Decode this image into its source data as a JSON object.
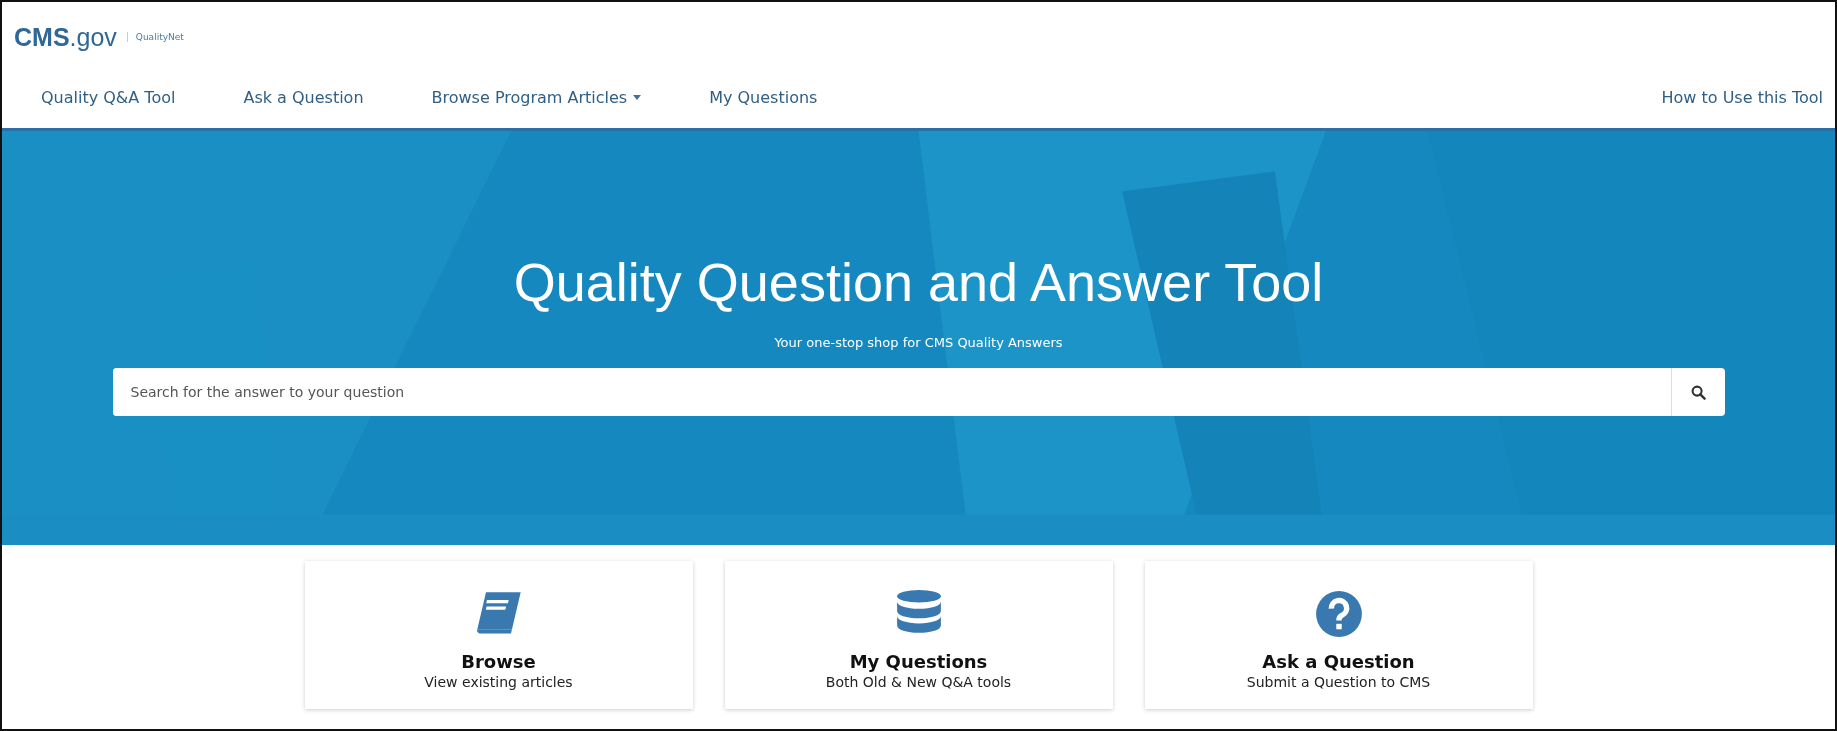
{
  "logo": {
    "brand": "CMS",
    "suffix": ".gov",
    "sub": "QualityNet"
  },
  "nav": {
    "items": [
      {
        "label": "Quality Q&A Tool",
        "dropdown": false
      },
      {
        "label": "Ask a Question",
        "dropdown": false
      },
      {
        "label": "Browse Program Articles",
        "dropdown": true
      },
      {
        "label": "My Questions",
        "dropdown": false
      }
    ],
    "right": "How to Use this Tool"
  },
  "hero": {
    "title": "Quality Question and Answer Tool",
    "subtitle": "Your one-stop shop for CMS Quality Answers",
    "search": {
      "placeholder": "Search for the answer to your question"
    }
  },
  "cards": [
    {
      "kind": "book",
      "title": "Browse",
      "subtitle": "View existing articles"
    },
    {
      "kind": "database",
      "title": "My Questions",
      "subtitle": "Both Old & New Q&A tools"
    },
    {
      "kind": "question",
      "title": "Ask a Question",
      "subtitle": "Submit a Question to CMS"
    }
  ]
}
